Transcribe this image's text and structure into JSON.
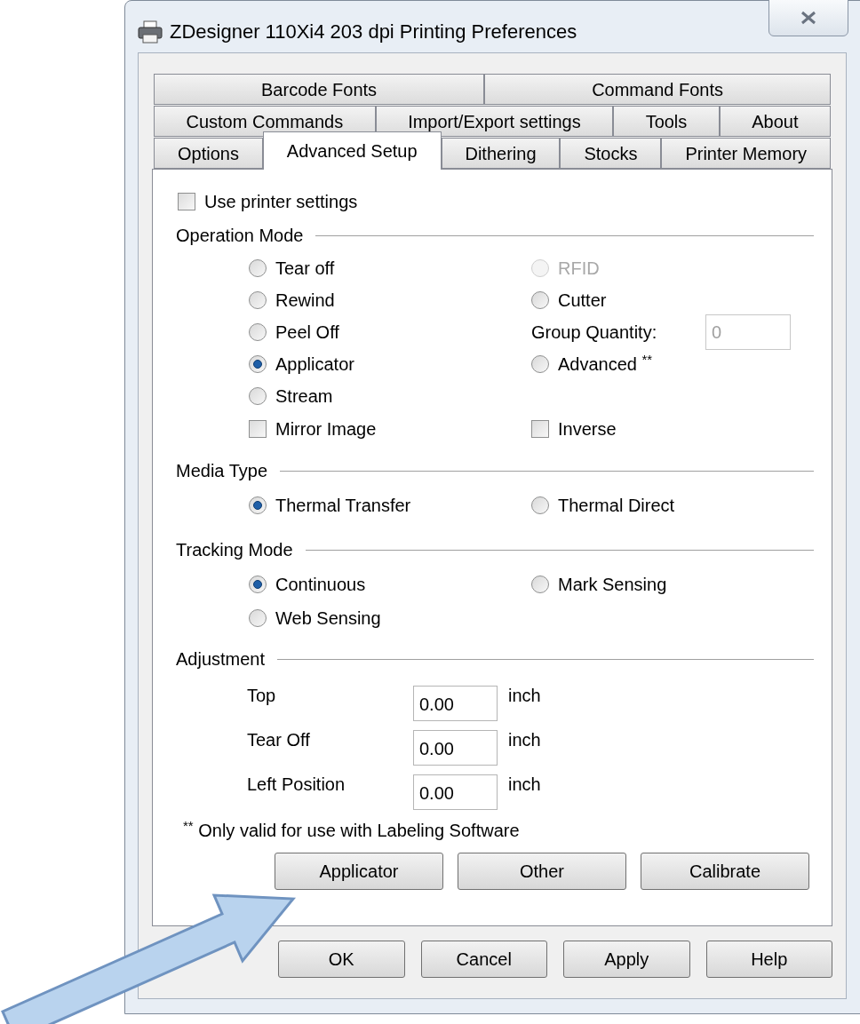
{
  "window": {
    "title": "ZDesigner 110Xi4 203 dpi Printing Preferences"
  },
  "tab_rows": [
    [
      {
        "label": "Barcode Fonts",
        "selected": false
      },
      {
        "label": "Command Fonts",
        "selected": false
      }
    ],
    [
      {
        "label": "Custom Commands",
        "selected": false
      },
      {
        "label": "Import/Export settings",
        "selected": false
      },
      {
        "label": "Tools",
        "selected": false
      },
      {
        "label": "About",
        "selected": false
      }
    ],
    [
      {
        "label": "Options",
        "selected": false
      },
      {
        "label": "Advanced Setup",
        "selected": true
      },
      {
        "label": "Dithering",
        "selected": false
      },
      {
        "label": "Stocks",
        "selected": false
      },
      {
        "label": "Printer Memory",
        "selected": false
      }
    ]
  ],
  "use_printer_settings": {
    "label": "Use printer settings",
    "checked": false
  },
  "operation_mode": {
    "title": "Operation Mode",
    "left_options": [
      {
        "label": "Tear off",
        "selected": false
      },
      {
        "label": "Rewind",
        "selected": false
      },
      {
        "label": "Peel Off",
        "selected": false
      },
      {
        "label": "Applicator",
        "selected": true
      },
      {
        "label": "Stream",
        "selected": false
      }
    ],
    "right_items": [
      {
        "kind": "radio",
        "label": "RFID",
        "selected": false,
        "disabled": true
      },
      {
        "kind": "radio",
        "label": "Cutter",
        "selected": false,
        "disabled": false
      },
      {
        "kind": "field",
        "label": "Group Quantity:",
        "value": "0",
        "disabled": true
      },
      {
        "kind": "radio",
        "label": "Advanced $^{**}$",
        "selected": false,
        "disabled": false
      }
    ],
    "checkboxes": [
      {
        "label": "Mirror Image",
        "checked": false
      },
      {
        "label": "Inverse",
        "checked": false
      }
    ]
  },
  "media_type": {
    "title": "Media Type",
    "options": [
      {
        "label": "Thermal Transfer",
        "selected": true
      },
      {
        "label": "Thermal Direct",
        "selected": false
      }
    ]
  },
  "tracking_mode": {
    "title": "Tracking Mode",
    "options": [
      {
        "label": "Continuous",
        "selected": true
      },
      {
        "label": "Mark Sensing",
        "selected": false
      },
      {
        "label": "Web Sensing",
        "selected": false
      }
    ]
  },
  "adjustment": {
    "title": "Adjustment",
    "rows": [
      {
        "label": "Top",
        "value": "0.00",
        "unit": "inch"
      },
      {
        "label": "Tear Off",
        "value": "0.00",
        "unit": "inch"
      },
      {
        "label": "Left Position",
        "value": "0.00",
        "unit": "inch"
      }
    ]
  },
  "footnote": "$^{**}$ Only valid for use with Labeling Software",
  "panel_buttons": [
    "Applicator",
    "Other",
    "Calibrate"
  ],
  "dialog_buttons": [
    "OK",
    "Cancel",
    "Apply",
    "Help"
  ]
}
